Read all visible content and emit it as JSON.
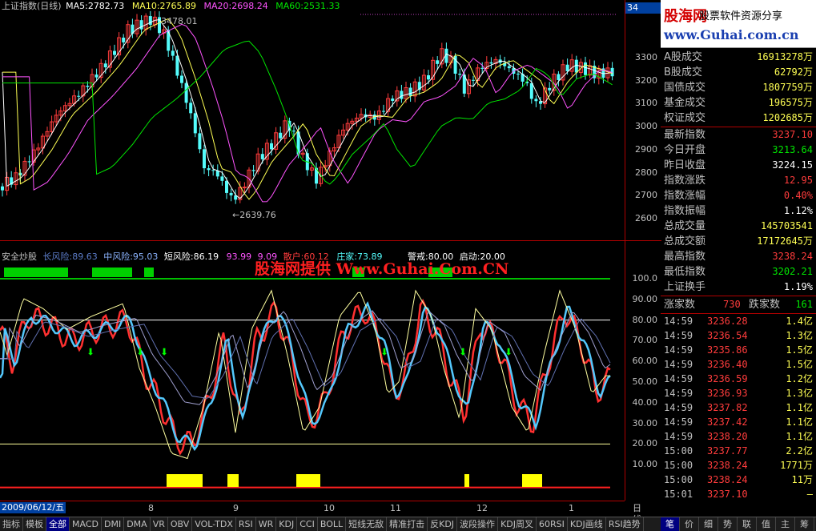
{
  "main_chart": {
    "title": "上证指数(日线)",
    "ma5": "MA5:2782.73",
    "ma10": "MA10:2765.89",
    "ma20": "MA20:2698.24",
    "ma60": "MA60:2531.33",
    "high_label": "3478.01",
    "low_label": "←2639.76",
    "corner": "34",
    "colors": {
      "up": "#ff3c3c",
      "down": "#54fcfc",
      "ma5": "#ffffff",
      "ma10": "#ffff54",
      "ma20": "#ff54ff",
      "ma60": "#00e600"
    }
  },
  "price_axis": [
    "3300",
    "3200",
    "3100",
    "3000",
    "2900",
    "2800",
    "2700",
    "2600"
  ],
  "indicator": {
    "name": "安全炒股",
    "long_risk": "长风险:89.63",
    "mid_risk": "中风险:95.03",
    "short_risk": "短风险:86.19",
    "mid_hidden": "93.99",
    "mid_hidden2": "9.09",
    "buy": "散户:60.12",
    "dealer": "庄家:73.89",
    "alert": "警戒:80.00",
    "start": "启动:20.00",
    "watermark": "股海网提供 Www.Guhai.Com.CN",
    "axis": [
      "100.0",
      "90.00",
      "80.00",
      "70.00",
      "60.00",
      "50.00",
      "40.00",
      "30.00",
      "20.00",
      "10.00"
    ]
  },
  "date_bar": {
    "current": "2009/06/12/五",
    "months": [
      "8",
      "9",
      "10",
      "11",
      "12",
      "1"
    ],
    "period": "日线"
  },
  "logo": {
    "brand": "股海网",
    "slogan": "股票软件资源分享",
    "url": "www.Guhai.com.cn"
  },
  "stats": [
    {
      "k": "A股成交",
      "v": "16913278万",
      "c": "#ffff54"
    },
    {
      "k": "B股成交",
      "v": "62792万",
      "c": "#ffff54"
    },
    {
      "k": "国债成交",
      "v": "1807759万",
      "c": "#ffff54"
    },
    {
      "k": "基金成交",
      "v": "196575万",
      "c": "#ffff54"
    },
    {
      "k": "权证成交",
      "v": "1202685万",
      "c": "#ffff54"
    }
  ],
  "index_info": [
    {
      "k": "最新指数",
      "v": "3237.10",
      "c": "#ff3c3c"
    },
    {
      "k": "今日开盘",
      "v": "3213.64",
      "c": "#00e600"
    },
    {
      "k": "昨日收盘",
      "v": "3224.15",
      "c": "#ffffff"
    },
    {
      "k": "指数涨跌",
      "v": "12.95",
      "c": "#ff3c3c"
    },
    {
      "k": "指数涨幅",
      "v": "0.40%",
      "c": "#ff3c3c"
    },
    {
      "k": "指数振幅",
      "v": "1.12%",
      "c": "#ffffff"
    },
    {
      "k": "总成交量",
      "v": "145703541",
      "c": "#ffff54"
    },
    {
      "k": "总成交额",
      "v": "17172645万",
      "c": "#ffff54"
    },
    {
      "k": "最高指数",
      "v": "3238.24",
      "c": "#ff3c3c"
    },
    {
      "k": "最低指数",
      "v": "3202.21",
      "c": "#00e600"
    },
    {
      "k": "上证换手",
      "v": "1.19%",
      "c": "#ffffff"
    }
  ],
  "breadth": {
    "up_label": "涨家数",
    "up": "730",
    "down_label": "跌家数",
    "down": "161"
  },
  "ticks": [
    {
      "t": "14:59",
      "p": "3236.28",
      "q": "1.4亿"
    },
    {
      "t": "14:59",
      "p": "3236.54",
      "q": "1.3亿"
    },
    {
      "t": "14:59",
      "p": "3235.86",
      "q": "1.5亿"
    },
    {
      "t": "14:59",
      "p": "3236.40",
      "q": "1.5亿"
    },
    {
      "t": "14:59",
      "p": "3236.59",
      "q": "1.2亿"
    },
    {
      "t": "14:59",
      "p": "3236.93",
      "q": "1.3亿"
    },
    {
      "t": "14:59",
      "p": "3237.82",
      "q": "1.1亿"
    },
    {
      "t": "14:59",
      "p": "3237.42",
      "q": "1.1亿"
    },
    {
      "t": "14:59",
      "p": "3238.20",
      "q": "1.1亿"
    },
    {
      "t": "15:00",
      "p": "3237.77",
      "q": "2.2亿"
    },
    {
      "t": "15:00",
      "p": "3238.24",
      "q": "1771万"
    },
    {
      "t": "15:00",
      "p": "3238.24",
      "q": "11万"
    },
    {
      "t": "15:01",
      "p": "3237.10",
      "q": "—"
    }
  ],
  "tabs": [
    "指标",
    "模板",
    "全部",
    "MACD",
    "DMI",
    "DMA",
    "VR",
    "OBV",
    "VOL-TDX",
    "RSI",
    "WR",
    "KDJ",
    "CCI",
    "BOLL",
    "短线无敌",
    "精准打击",
    "反KDJ",
    "波段操作",
    "KDJ周叉",
    "60RSI",
    "KDJ画线",
    "RSI趋势"
  ],
  "active_tab": "全部",
  "right_tabs": [
    "笔",
    "价",
    "细",
    "势",
    "联",
    "值",
    "主",
    "筹"
  ],
  "active_right_tab": "笔"
}
